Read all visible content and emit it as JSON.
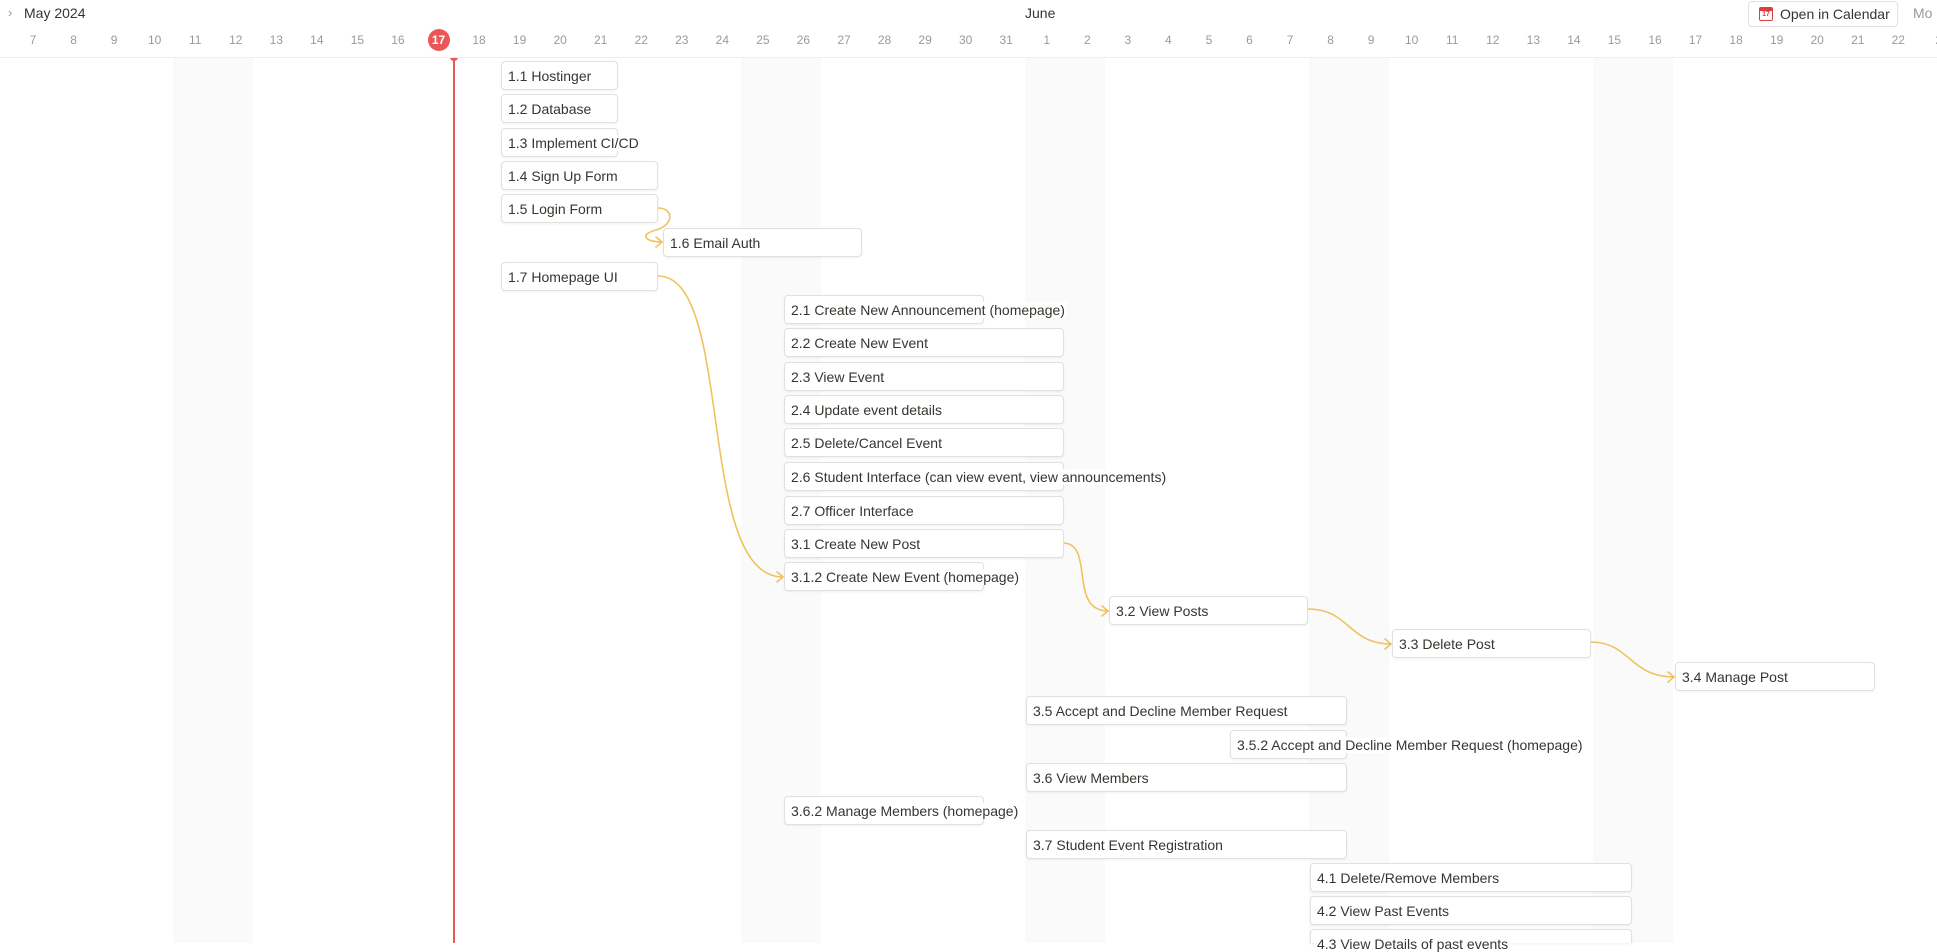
{
  "header": {
    "month_left": "May 2024",
    "month_right": "June",
    "open_calendar_label": "Open in Calendar",
    "calendar_icon_day": "17",
    "more_label": "Mo",
    "days": [
      "7",
      "8",
      "9",
      "10",
      "11",
      "12",
      "13",
      "14",
      "15",
      "16",
      "17",
      "18",
      "19",
      "20",
      "21",
      "22",
      "23",
      "24",
      "25",
      "26",
      "27",
      "28",
      "29",
      "30",
      "31",
      "1",
      "2",
      "3",
      "4",
      "5",
      "6",
      "7",
      "8",
      "9",
      "10",
      "11",
      "12",
      "13",
      "14",
      "15",
      "16",
      "17",
      "18",
      "19",
      "20",
      "21",
      "22",
      "2"
    ],
    "today": "17"
  },
  "colors": {
    "today_marker": "#eb5757",
    "dependency_arrow": "#f0c25e",
    "weekend_band": "#fafafa"
  },
  "tasks": [
    "1.1 Hostinger",
    "1.2 Database",
    "1.3 Implement CI/CD",
    "1.4 Sign Up Form",
    "1.5 Login Form",
    "1.6 Email Auth",
    "1.7 Homepage UI",
    "2.1 Create New Announcement (homepage)",
    "2.2 Create New Event",
    "2.3 View Event",
    "2.4 Update event details",
    "2.5 Delete/Cancel Event",
    "2.6 Student Interface (can view event, view announcements)",
    "2.7 Officer Interface",
    "3.1 Create New Post",
    "3.1.2 Create New Event (homepage)",
    "3.2 View Posts",
    "3.3 Delete Post",
    "3.4 Manage Post",
    "3.5 Accept and Decline Member Request",
    "3.5.2 Accept and Decline Member Request (homepage)",
    "3.6 View Members",
    "3.6.2 Manage Members (homepage)",
    "3.7 Student Event Registration",
    "4.1 Delete/Remove Members",
    "4.2 View Past Events",
    "4.3 View Details of past events"
  ]
}
